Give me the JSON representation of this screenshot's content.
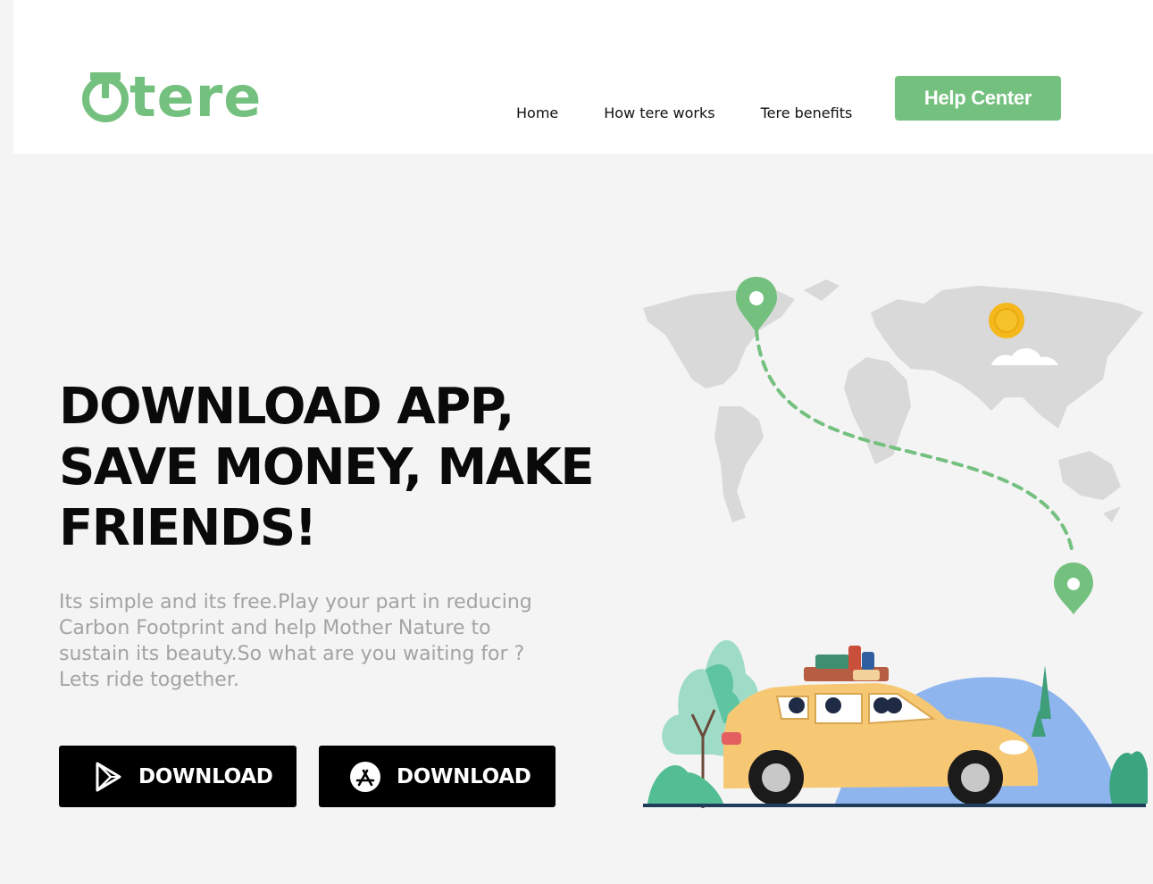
{
  "header": {
    "logo_text": "tere",
    "nav": [
      {
        "label": "Home"
      },
      {
        "label": "How tere works"
      },
      {
        "label": "Tere benefits"
      }
    ],
    "help_button": "Help Center"
  },
  "hero": {
    "title_lines": [
      "DOWNLOAD APP,",
      "SAVE MONEY, MAKE",
      "FRIENDS!"
    ],
    "description": "Its simple and its free.Play your part in reducing Carbon Footprint and help Mother Nature to sustain its beauty.So what are you waiting for ? Lets ride together.",
    "downloads": [
      {
        "label": "DOWNLOAD",
        "icon": "google-play-icon"
      },
      {
        "label": "DOWNLOAD",
        "icon": "app-store-icon"
      }
    ]
  },
  "colors": {
    "brand_green": "#74c07f",
    "background": "#f4f4f4",
    "header_bg": "#ffffff",
    "button_black": "#000000",
    "text_dark": "#0a0a0a",
    "text_muted": "#a3a3a3"
  },
  "illustration": {
    "icons": [
      "world-map-icon",
      "location-pin-icon",
      "sun-icon",
      "cloud-icon",
      "car-icon",
      "luggage-icon",
      "tree-icon"
    ]
  }
}
